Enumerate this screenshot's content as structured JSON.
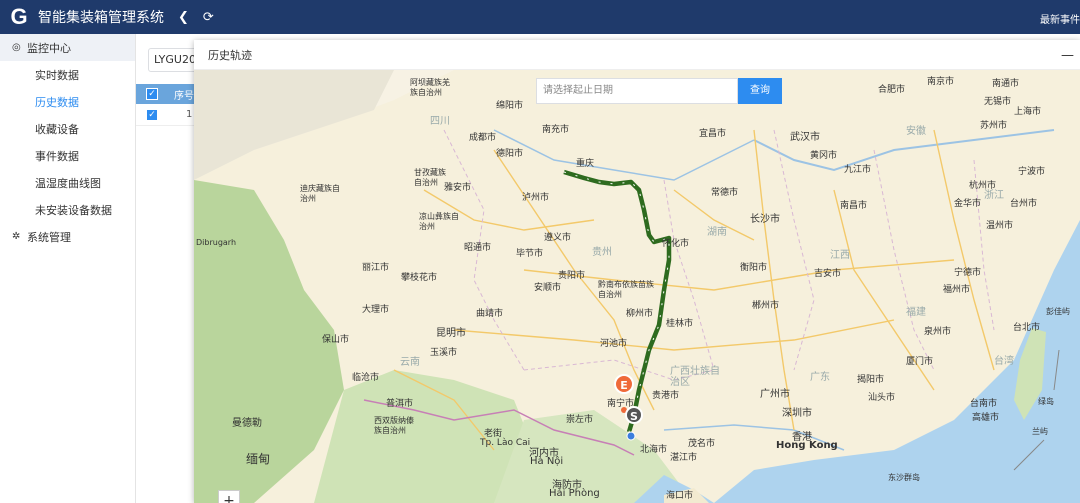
{
  "header": {
    "logo": "G",
    "app_title": "智能集装箱管理系统",
    "back_label": "❮",
    "refresh_label": "⟳",
    "right_text": "最新事件"
  },
  "sidebar": {
    "monitor_group": "监控中心",
    "items": [
      {
        "label": "实时数据"
      },
      {
        "label": "历史数据"
      },
      {
        "label": "收藏设备"
      },
      {
        "label": "事件数据"
      },
      {
        "label": "温湿度曲线图"
      },
      {
        "label": "未安装设备数据"
      }
    ],
    "system_group": "系统管理"
  },
  "main": {
    "search_value": "LYGU203",
    "table": {
      "header_no": "序号",
      "row_no": "1"
    }
  },
  "modal": {
    "title": "历史轨迹",
    "minimize": "—",
    "date_placeholder": "请选择起止日期",
    "query_button": "查询",
    "zoom_in": "+",
    "markers": {
      "end": "E",
      "start": "S"
    },
    "map_labels": [
      {
        "text": "成都市"
      },
      {
        "text": "德阳市"
      },
      {
        "text": "绵阳市"
      },
      {
        "text": "南充市"
      },
      {
        "text": "四川"
      },
      {
        "text": "泸州市"
      },
      {
        "text": "重庆"
      },
      {
        "text": "贵阳市"
      },
      {
        "text": "贵州"
      },
      {
        "text": "遵义市"
      },
      {
        "text": "怀化市"
      },
      {
        "text": "湖南"
      },
      {
        "text": "长沙市"
      },
      {
        "text": "武汉市"
      },
      {
        "text": "宜昌市"
      },
      {
        "text": "常德市"
      },
      {
        "text": "黄冈市"
      },
      {
        "text": "九江市"
      },
      {
        "text": "南昌市"
      },
      {
        "text": "江西"
      },
      {
        "text": "吉安市"
      },
      {
        "text": "衡阳市"
      },
      {
        "text": "郴州市"
      },
      {
        "text": "桂林市"
      },
      {
        "text": "柳州市"
      },
      {
        "text": "广西壮族自治区"
      },
      {
        "text": "南宁市"
      },
      {
        "text": "河池市"
      },
      {
        "text": "贵港市"
      },
      {
        "text": "广州市"
      },
      {
        "text": "深圳市"
      },
      {
        "text": "香港"
      },
      {
        "text": "Hong Kong"
      },
      {
        "text": "广东"
      },
      {
        "text": "揭阳市"
      },
      {
        "text": "汕头市"
      },
      {
        "text": "福建"
      },
      {
        "text": "福州市"
      },
      {
        "text": "泉州市"
      },
      {
        "text": "厦门市"
      },
      {
        "text": "台北市"
      },
      {
        "text": "台南市"
      },
      {
        "text": "高雄市"
      },
      {
        "text": "台湾"
      },
      {
        "text": "杭州市"
      },
      {
        "text": "宁波市"
      },
      {
        "text": "金华市"
      },
      {
        "text": "台州市"
      },
      {
        "text": "温州市"
      },
      {
        "text": "浙江"
      },
      {
        "text": "南京市"
      },
      {
        "text": "南通市"
      },
      {
        "text": "无锡市"
      },
      {
        "text": "苏州市"
      },
      {
        "text": "上海市"
      },
      {
        "text": "合肥市"
      },
      {
        "text": "安徽"
      },
      {
        "text": "宁德市"
      },
      {
        "text": "昆明市"
      },
      {
        "text": "云南"
      },
      {
        "text": "曲靖市"
      },
      {
        "text": "大理市"
      },
      {
        "text": "丽江市"
      },
      {
        "text": "玉溪市"
      },
      {
        "text": "普洱市"
      },
      {
        "text": "昭通市"
      },
      {
        "text": "毕节市"
      },
      {
        "text": "安顺市"
      },
      {
        "text": "黔南布依族苗族自治州"
      },
      {
        "text": "凉山彝族自治州"
      },
      {
        "text": "攀枝花市"
      },
      {
        "text": "河内市"
      },
      {
        "text": "Hà Nội"
      },
      {
        "text": "海防市"
      },
      {
        "text": "Hải Phòng"
      },
      {
        "text": "老街"
      },
      {
        "text": "Tp. Lào Cai"
      },
      {
        "text": "曼德勒"
      },
      {
        "text": "缅甸"
      },
      {
        "text": "海口市"
      },
      {
        "text": "湛江市"
      },
      {
        "text": "茂名市"
      },
      {
        "text": "崇左市"
      },
      {
        "text": "北海市"
      },
      {
        "text": "西双版纳傣族自治州"
      },
      {
        "text": "临沧市"
      },
      {
        "text": "保山市"
      },
      {
        "text": "雅安市"
      },
      {
        "text": "甘孜藏族自治州"
      },
      {
        "text": "迪庆藏族自治州"
      },
      {
        "text": "阿坝藏族羌族自治州"
      },
      {
        "text": "东沙群岛"
      },
      {
        "text": "彭佳屿"
      },
      {
        "text": "绿岛"
      },
      {
        "text": "兰屿"
      },
      {
        "text": "Dibrugarh"
      }
    ]
  }
}
